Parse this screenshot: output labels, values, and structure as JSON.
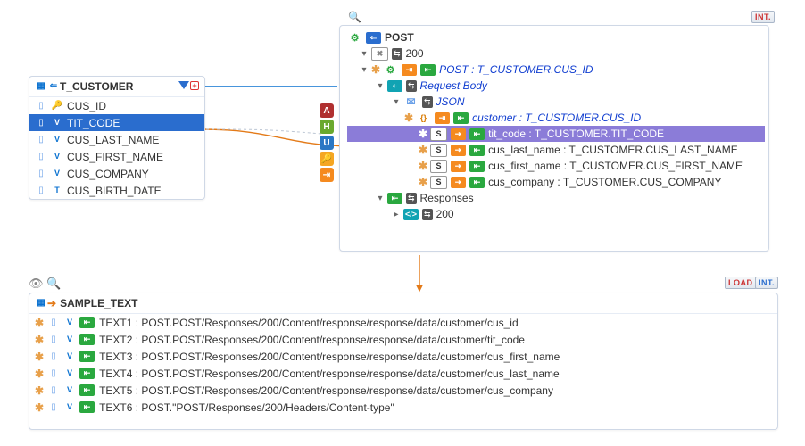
{
  "tcustomer": {
    "title": "T_CUSTOMER",
    "columns": [
      "CUS_ID",
      "TIT_CODE",
      "CUS_LAST_NAME",
      "CUS_FIRST_NAME",
      "CUS_COMPANY",
      "CUS_BIRTH_DATE"
    ]
  },
  "tree": {
    "post": "POST",
    "code200": "200",
    "postCusId": "POST : T_CUSTOMER.CUS_ID",
    "requestBody": "Request Body",
    "json": "JSON",
    "customer": "customer : T_CUSTOMER.CUS_ID",
    "fields": [
      "tit_code : T_CUSTOMER.TIT_CODE",
      "cus_last_name : T_CUSTOMER.CUS_LAST_NAME",
      "cus_first_name : T_CUSTOMER.CUS_FIRST_NAME",
      "cus_company : T_CUSTOMER.CUS_COMPANY"
    ],
    "responses": "Responses"
  },
  "badges": {
    "int": "INT.",
    "load": "LOAD"
  },
  "sample": {
    "title": "SAMPLE_TEXT",
    "rows": [
      {
        "name": "TEXT1",
        "path": "POST.POST/Responses/200/Content/response/response/data/customer/cus_id"
      },
      {
        "name": "TEXT2",
        "path": "POST.POST/Responses/200/Content/response/response/data/customer/tit_code"
      },
      {
        "name": "TEXT3",
        "path": "POST.POST/Responses/200/Content/response/response/data/customer/cus_first_name"
      },
      {
        "name": "TEXT4",
        "path": "POST.POST/Responses/200/Content/response/response/data/customer/cus_last_name"
      },
      {
        "name": "TEXT5",
        "path": "POST.POST/Responses/200/Content/response/response/data/customer/cus_company"
      },
      {
        "name": "TEXT6",
        "path": "POST.\"POST/Responses/200/Headers/Content-type\""
      }
    ]
  }
}
